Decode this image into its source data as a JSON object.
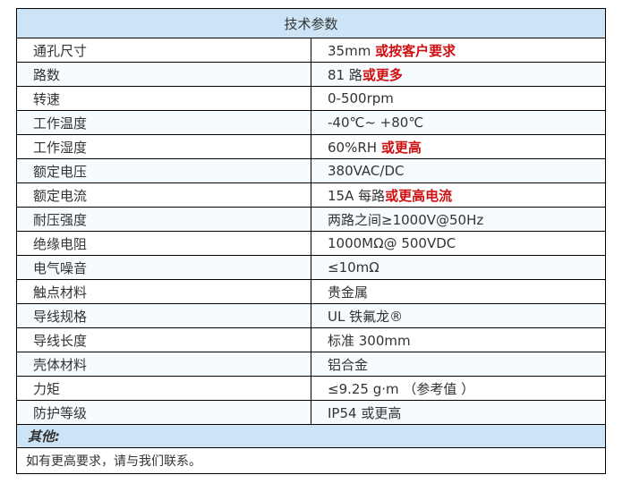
{
  "table": {
    "title": "技术参数",
    "rows": [
      {
        "name": "通孔尺寸",
        "value": "35mm ",
        "highlight": "或按客户要求"
      },
      {
        "name": "路数",
        "value": "81 路",
        "highlight": "或更多"
      },
      {
        "name": "转速",
        "value": "0-500rpm",
        "highlight": ""
      },
      {
        "name": "工作温度",
        "value": "-40℃~ +80℃",
        "highlight": ""
      },
      {
        "name": "工作湿度",
        "value": "60%RH ",
        "highlight": "或更高"
      },
      {
        "name": "额定电压",
        "value": "380VAC/DC",
        "highlight": ""
      },
      {
        "name": "额定电流",
        "value": "15A 每路",
        "highlight": "或更高电流"
      },
      {
        "name": "耐压强度",
        "value": "两路之间≥1000V@50Hz",
        "highlight": ""
      },
      {
        "name": "绝缘电阻",
        "value": "1000MΩ@ 500VDC",
        "highlight": ""
      },
      {
        "name": "电气噪音",
        "value": "≤10mΩ",
        "highlight": ""
      },
      {
        "name": "触点材料",
        "value": "贵金属",
        "highlight": ""
      },
      {
        "name": "导线规格",
        "value": "UL 铁氟龙®",
        "highlight": ""
      },
      {
        "name": "导线长度",
        "value": "标准 300mm",
        "highlight": ""
      },
      {
        "name": "壳体材料",
        "value": "铝合金",
        "highlight": ""
      },
      {
        "name": "力矩",
        "value": "≤9.25 g·m （参考值 ）",
        "highlight": ""
      },
      {
        "name": "防护等级",
        "value": "IP54 或更高",
        "highlight": ""
      }
    ],
    "other_label": "其他:",
    "note": "如有更高要求，请与我们联系。"
  },
  "colors": {
    "header_background": "#cde4f6",
    "highlight_text": "#d01010",
    "border": "#000000",
    "text": "#333333"
  }
}
